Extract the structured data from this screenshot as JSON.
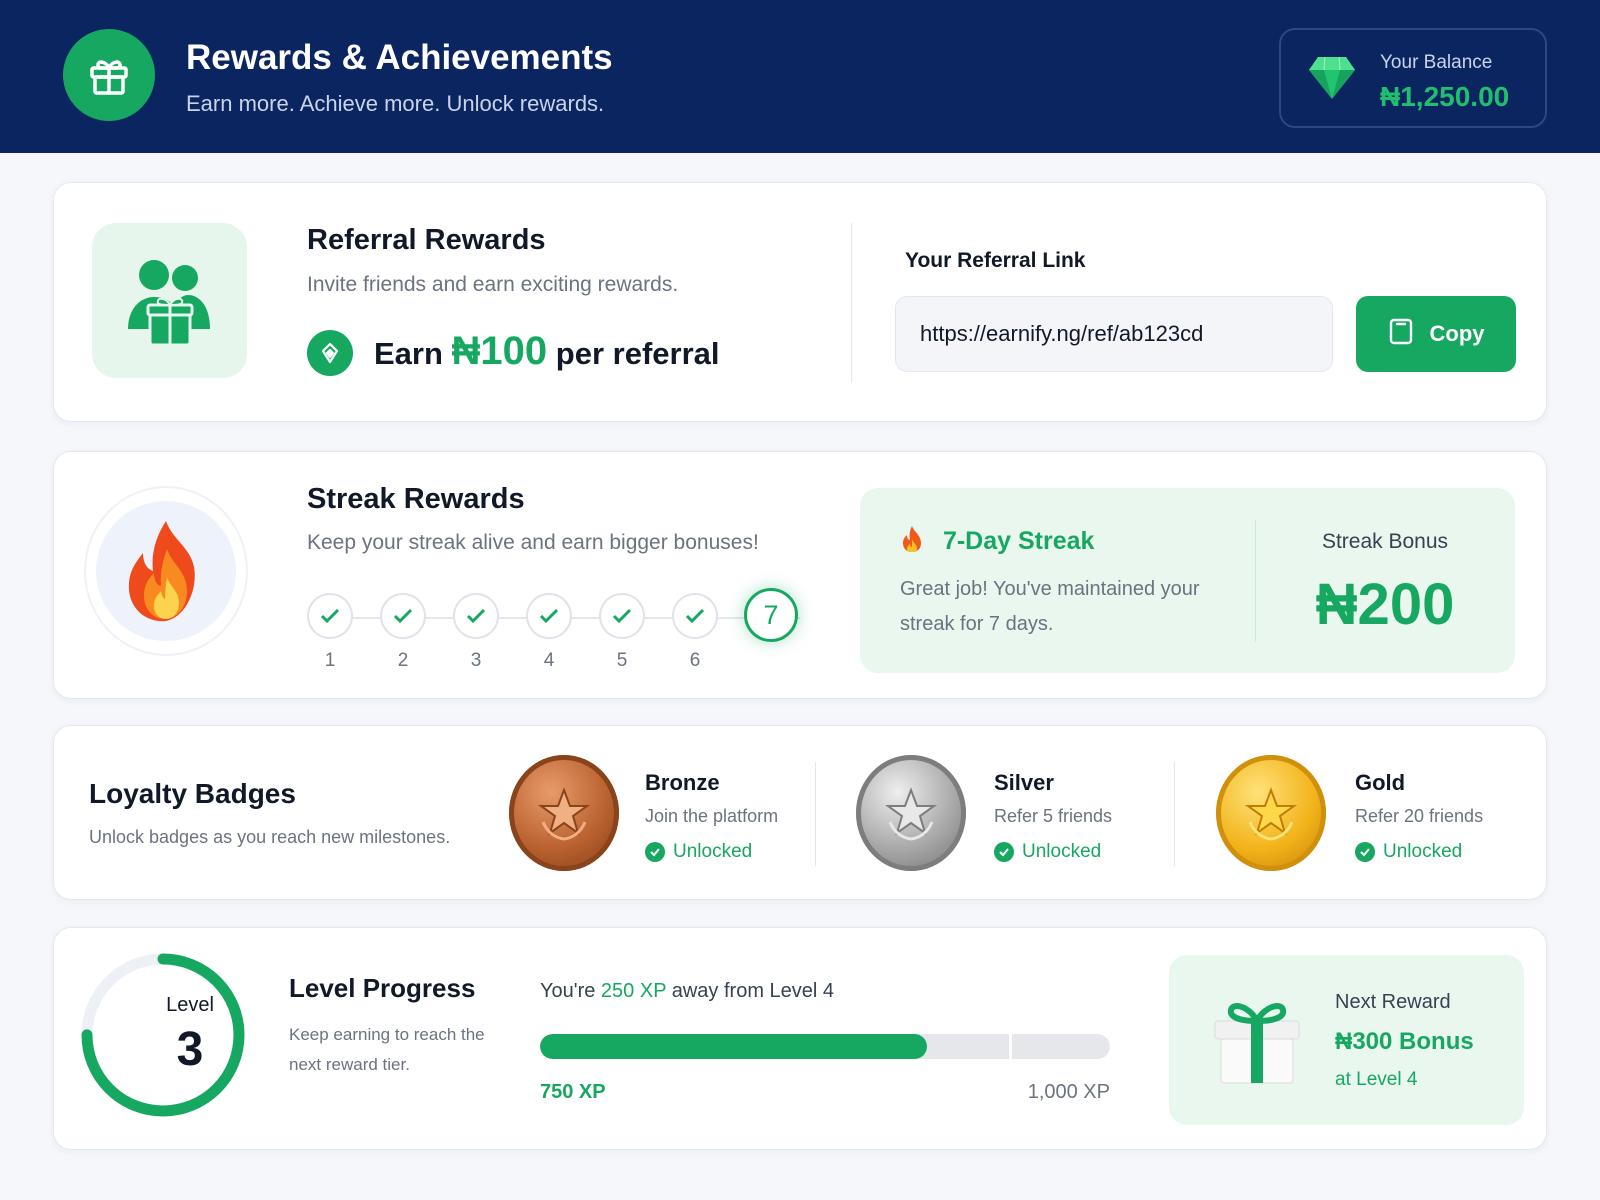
{
  "header": {
    "title": "Rewards & Achievements",
    "subtitle": "Earn more. Achieve more. Unlock rewards.",
    "icon": "gift-icon",
    "balance_label": "Your Balance",
    "balance_value": "₦1,250.00",
    "balance_icon": "gem-icon"
  },
  "referral": {
    "title": "Referral Rewards",
    "subtitle": "Invite friends and earn exciting rewards.",
    "earn_prefix": "Earn",
    "earn_amount": "₦100",
    "earn_suffix": "per referral",
    "link_label": "Your Referral Link",
    "link_value": "https://earnify.ng/ref/ab123cd",
    "copy_label": "Copy"
  },
  "streak": {
    "title": "Streak Rewards",
    "subtitle": "Keep your streak alive and earn bigger bonuses!",
    "days": [
      "1",
      "2",
      "3",
      "4",
      "5",
      "6",
      "7"
    ],
    "completed_days": 6,
    "panel_title": "7-Day Streak",
    "panel_text": "Great job! You've maintained your streak for 7 days.",
    "bonus_label": "Streak Bonus",
    "bonus_value": "₦200"
  },
  "badges": {
    "title": "Loyalty Badges",
    "subtitle": "Unlock badges as you reach new milestones.",
    "items": [
      {
        "name": "Bronze",
        "desc": "Join the platform",
        "status": "Unlocked"
      },
      {
        "name": "Silver",
        "desc": "Refer 5 friends",
        "status": "Unlocked"
      },
      {
        "name": "Gold",
        "desc": "Refer 20 friends",
        "status": "Unlocked"
      }
    ]
  },
  "level": {
    "label": "Level",
    "number": "3",
    "title": "Level Progress",
    "subtitle": "Keep earning to reach the next reward tier.",
    "away_prefix": "You're",
    "away_xp": "250 XP",
    "away_suffix": "away from Level 4",
    "current_xp": "750 XP",
    "max_xp": "1,000 XP",
    "progress": 0.75,
    "next_label": "Next Reward",
    "next_value": "₦300 Bonus",
    "next_level": "at Level 4"
  },
  "colors": {
    "brand_navy": "#0b2560",
    "accent_green": "#16a861"
  }
}
